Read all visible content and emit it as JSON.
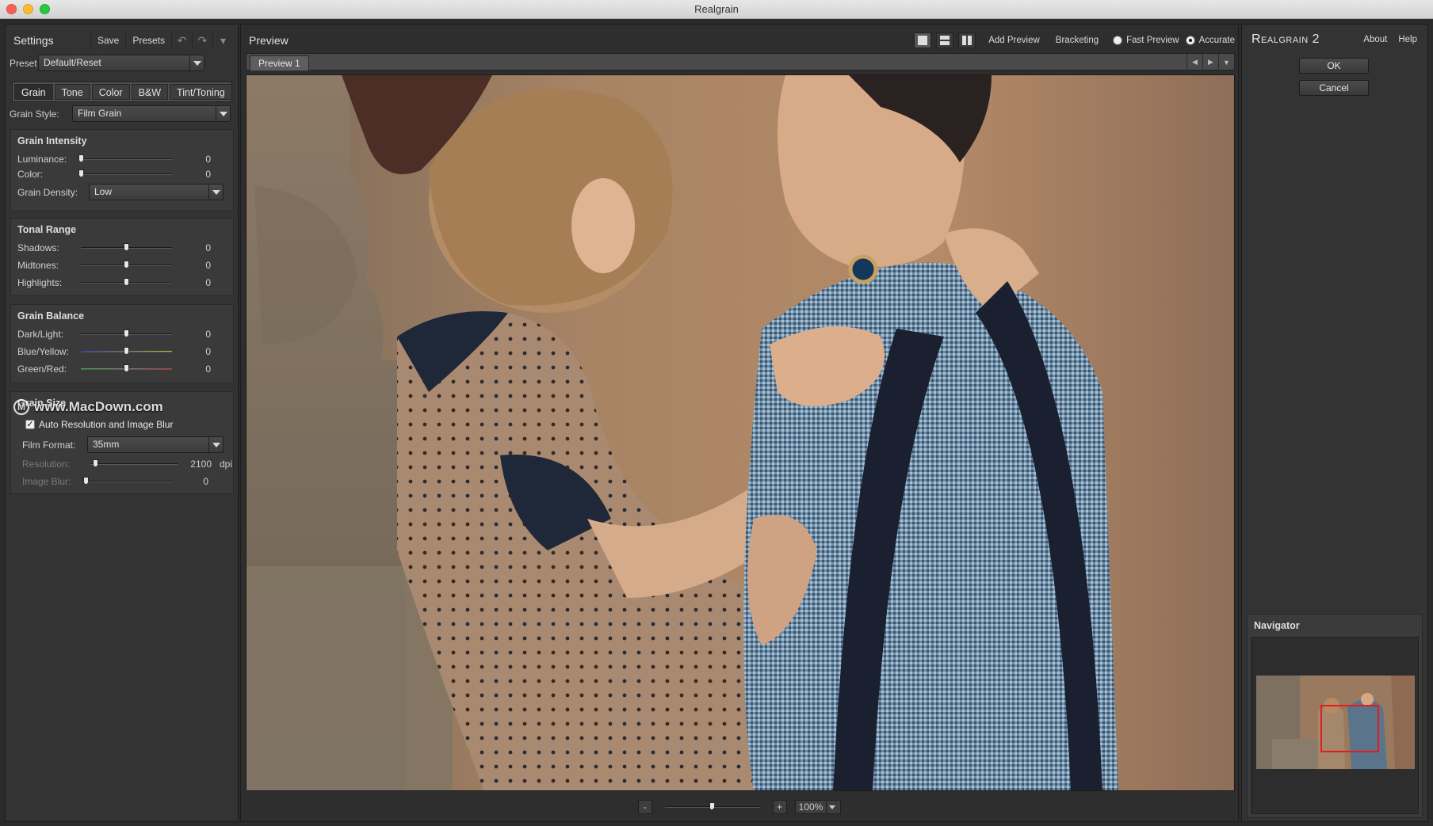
{
  "window": {
    "title": "Realgrain"
  },
  "settings": {
    "title": "Settings",
    "save_label": "Save",
    "presets_label": "Presets",
    "preset_label": "Preset",
    "preset_value": "Default/Reset",
    "tabs": [
      "Grain",
      "Tone",
      "Color",
      "B&W",
      "Tint/Toning"
    ],
    "active_tab": "Grain",
    "grain_style_label": "Grain Style:",
    "grain_style_value": "Film Grain"
  },
  "grain_intensity": {
    "title": "Grain Intensity",
    "luminance": {
      "label": "Luminance:",
      "value": "0"
    },
    "color": {
      "label": "Color:",
      "value": "0"
    },
    "density_label": "Grain Density:",
    "density_value": "Low"
  },
  "tonal_range": {
    "title": "Tonal Range",
    "shadows": {
      "label": "Shadows:",
      "value": "0"
    },
    "midtones": {
      "label": "Midtones:",
      "value": "0"
    },
    "highlights": {
      "label": "Highlights:",
      "value": "0"
    }
  },
  "grain_balance": {
    "title": "Grain Balance",
    "dark_light": {
      "label": "Dark/Light:",
      "value": "0"
    },
    "blue_yellow": {
      "label": "Blue/Yellow:",
      "value": "0"
    },
    "green_red": {
      "label": "Green/Red:",
      "value": "0"
    }
  },
  "grain_size": {
    "title": "Grain Size",
    "auto_label": "Auto Resolution and Image Blur",
    "auto_checked": true,
    "film_format_label": "Film Format:",
    "film_format_value": "35mm",
    "resolution": {
      "label": "Resolution:",
      "value": "2100",
      "unit": "dpi"
    },
    "image_blur": {
      "label": "Image Blur:",
      "value": "0"
    }
  },
  "watermark": {
    "text": "www.MacDown.com",
    "logo": "M"
  },
  "preview": {
    "title": "Preview",
    "add_preview_label": "Add Preview",
    "bracketing_label": "Bracketing",
    "fast_preview_label": "Fast Preview",
    "accurate_label": "Accurate",
    "tab_label": "Preview 1",
    "zoom_minus": "-",
    "zoom_plus": "+",
    "zoom_value": "100%"
  },
  "right_panel": {
    "logo_text": "Realgrain 2",
    "about_label": "About",
    "help_label": "Help",
    "ok_label": "OK",
    "cancel_label": "Cancel",
    "navigator_title": "Navigator"
  }
}
